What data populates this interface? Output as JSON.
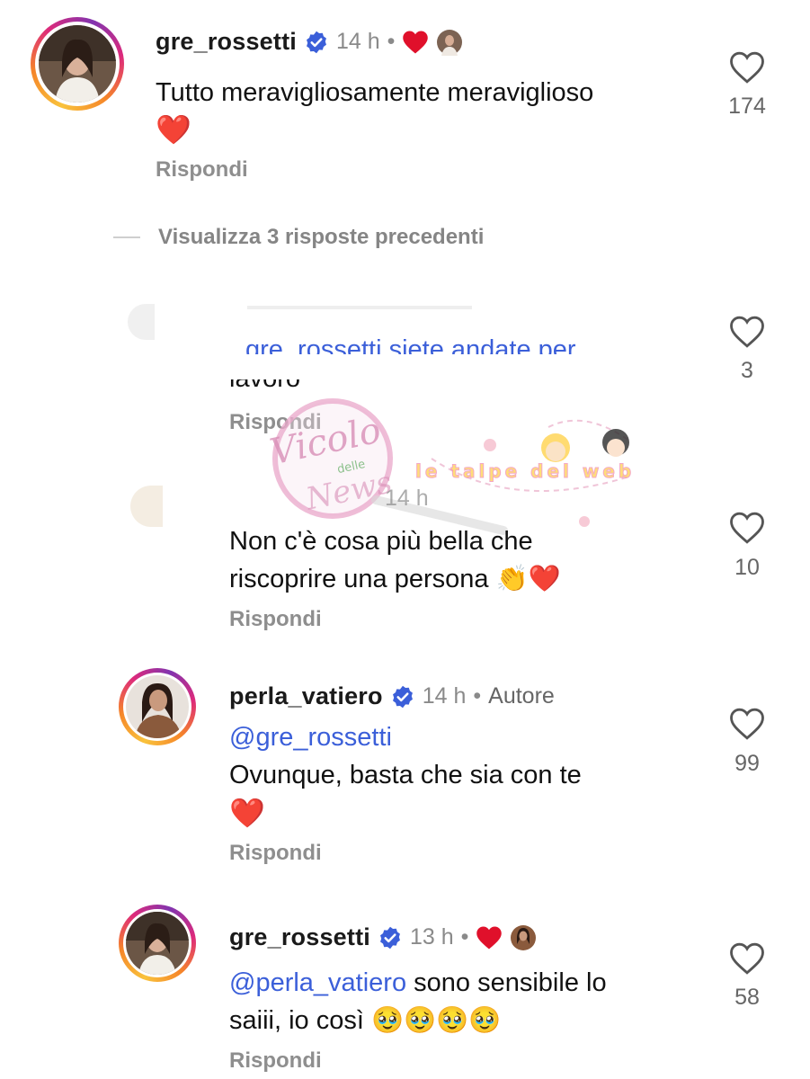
{
  "comments": [
    {
      "username": "gre_rossetti",
      "time": "14 h",
      "text": "Tutto meravigliosamente meraviglioso",
      "emoji_line": "❤️",
      "reply_label": "Rispondi",
      "likes": "174"
    },
    {
      "visible_fragment_1": "gre_rossetti siete andate per",
      "visible_fragment_2": "lavoro",
      "reply_label": "Rispondi",
      "likes": "3"
    },
    {
      "time": "14 h",
      "text_line1": "Non c'è cosa più bella che",
      "text_line2": "riscoprire una persona 👏❤️",
      "reply_label": "Rispondi",
      "likes": "10"
    },
    {
      "username": "perla_vatiero",
      "time": "14 h",
      "author_label": "Autore",
      "mention": "@gre_rossetti",
      "text": "Ovunque, basta che sia con te",
      "emoji_line": "❤️",
      "reply_label": "Rispondi",
      "likes": "99"
    },
    {
      "username": "gre_rossetti",
      "time": "13 h",
      "mention": "@perla_vatiero",
      "text_line1": " sono sensibile lo",
      "text_line2": "saiii, io così 🥹🥹🥹🥹",
      "reply_label": "Rispondi",
      "likes": "58"
    }
  ],
  "view_previous": "Visualizza 3 risposte precedenti",
  "separator": "•",
  "watermark": {
    "left_word1": "Vicolo",
    "left_word2": "delle",
    "left_word3": "News",
    "right_text": "le talpe del web"
  },
  "colors": {
    "verified": "#3b5fd9",
    "mention": "#3b5fd9",
    "heart_red": "#e0102b",
    "secondary_text": "#8e8e8e"
  },
  "icons": [
    "verified-badge-icon",
    "heart-outline-icon",
    "red-heart-icon"
  ]
}
